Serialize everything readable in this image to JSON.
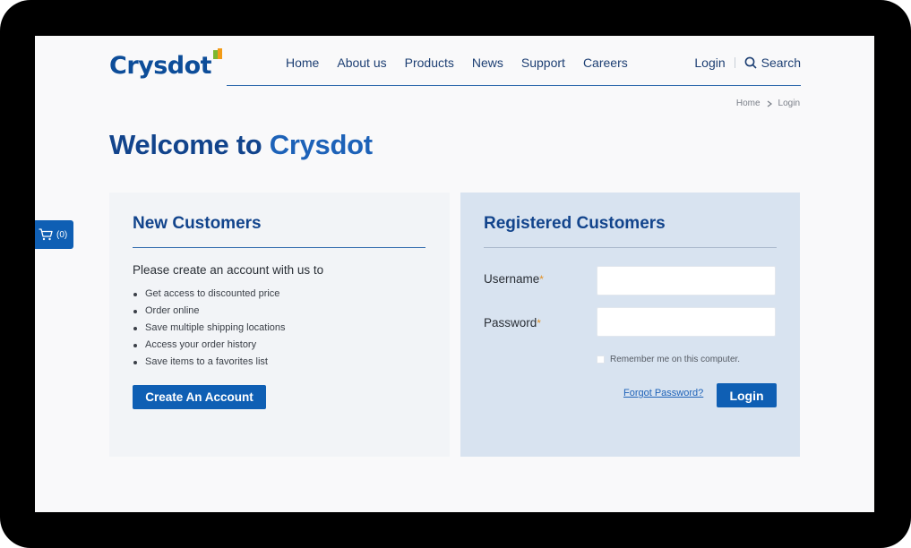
{
  "brand": {
    "name": "Crysdot"
  },
  "nav": {
    "items": [
      {
        "label": "Home"
      },
      {
        "label": "About us"
      },
      {
        "label": "Products"
      },
      {
        "label": "News"
      },
      {
        "label": "Support"
      },
      {
        "label": "Careers"
      }
    ],
    "login_label": "Login",
    "search_label": "Search",
    "search_icon": "search-icon"
  },
  "breadcrumb": {
    "home": "Home",
    "current": "Login"
  },
  "page": {
    "title_prefix": "Welcome to ",
    "title_brand": "Crysdot"
  },
  "cart": {
    "count": "(0)",
    "icon": "cart-icon"
  },
  "new_customers": {
    "title": "New Customers",
    "intro": "Please create an account with us to",
    "benefits": [
      "Get access to discounted price",
      "Order online",
      "Save multiple shipping locations",
      "Access your order history",
      "Save items to a favorites list"
    ],
    "button_label": "Create An Account"
  },
  "registered_customers": {
    "title": "Registered Customers",
    "username_label": "Username",
    "password_label": "Password",
    "required_marker": "*",
    "username_value": "",
    "password_value": "",
    "remember_label": "Remember me on this computer.",
    "forgot_label": "Forgot Password?",
    "login_button_label": "Login"
  },
  "colors": {
    "primary": "#0f5fb4",
    "heading": "#12448c",
    "logo_green": "#7cb82f",
    "logo_orange": "#f29b17",
    "required": "#e0922a",
    "registered_panel_bg": "#d8e3f0"
  }
}
